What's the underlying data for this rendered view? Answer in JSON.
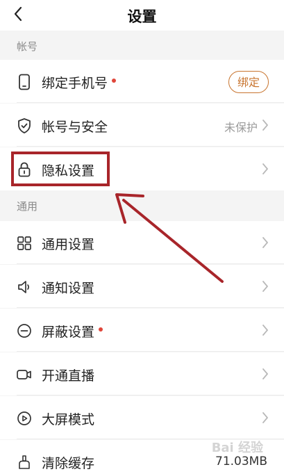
{
  "header": {
    "title": "设置"
  },
  "sections": {
    "account": "帐号",
    "general": "通用"
  },
  "rows": {
    "bind_phone": {
      "label": "绑定手机号",
      "button": "绑定"
    },
    "account_security": {
      "label": "帐号与安全",
      "value": "未保护"
    },
    "privacy": {
      "label": "隐私设置"
    },
    "general_settings": {
      "label": "通用设置"
    },
    "notification": {
      "label": "通知设置"
    },
    "block": {
      "label": "屏蔽设置"
    },
    "live": {
      "label": "开通直播"
    },
    "bigscreen": {
      "label": "大屏模式"
    },
    "cache": {
      "label": "清除缓存",
      "value": "71.03MB"
    }
  },
  "colors": {
    "accent": "#c8742e",
    "badge_dot": "#e0463a",
    "annotation": "#a8252a"
  },
  "watermark": "Bai 经验"
}
